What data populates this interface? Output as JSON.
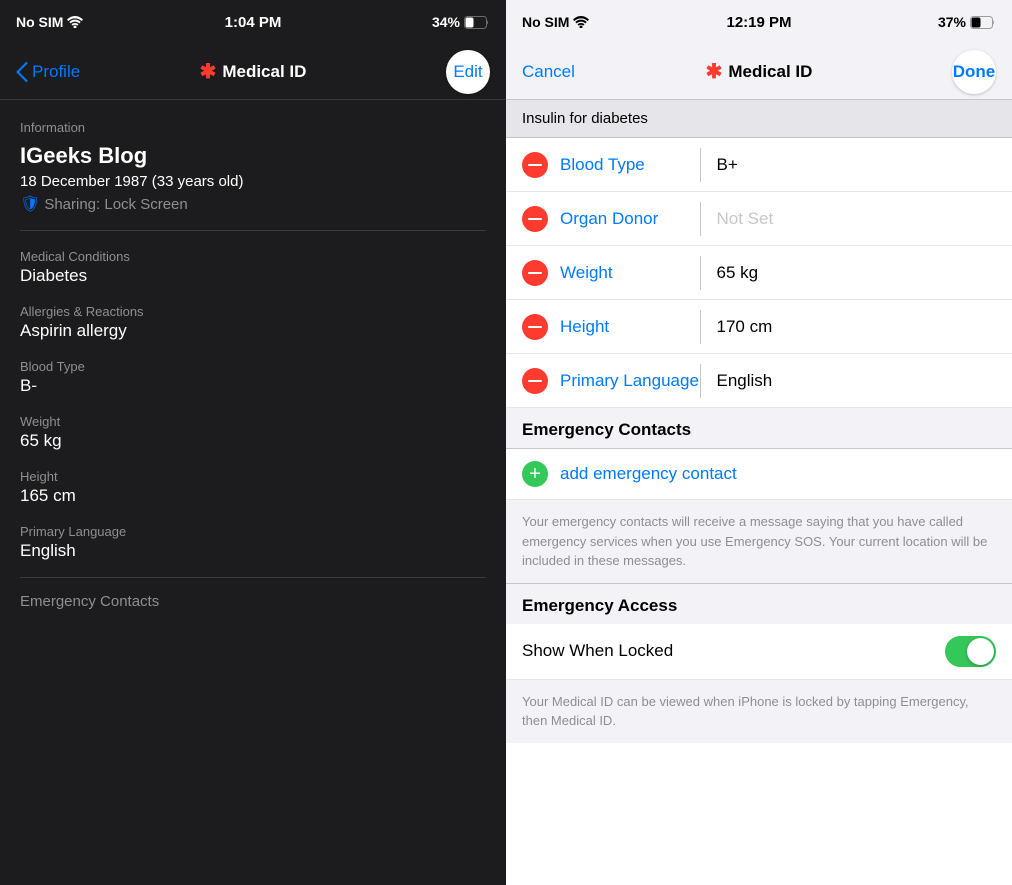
{
  "left": {
    "status": {
      "carrier": "No SIM",
      "time": "1:04 PM",
      "battery": "34%"
    },
    "nav": {
      "back_label": "Profile",
      "title": "Medical ID",
      "action_label": "Edit"
    },
    "section_info": "Information",
    "name": "IGeeks Blog",
    "dob": "18 December 1987 (33 years old)",
    "sharing": "Sharing: Lock Screen",
    "fields": [
      {
        "label": "Medical Conditions",
        "value": "Diabetes"
      },
      {
        "label": "Allergies & Reactions",
        "value": "Aspirin allergy"
      },
      {
        "label": "Blood Type",
        "value": "B-"
      },
      {
        "label": "Weight",
        "value": "65 kg"
      },
      {
        "label": "Height",
        "value": "165 cm"
      },
      {
        "label": "Primary Language",
        "value": "English"
      },
      {
        "label": "",
        "value": "Emergency Contacts"
      }
    ]
  },
  "right": {
    "status": {
      "carrier": "No SIM",
      "time": "12:19 PM",
      "battery": "37%"
    },
    "nav": {
      "cancel_label": "Cancel",
      "title": "Medical ID",
      "done_label": "Done"
    },
    "subtitle": "Insulin for diabetes",
    "rows": [
      {
        "label": "Blood Type",
        "value": "B+"
      },
      {
        "label": "Organ Donor",
        "value": "Not Set"
      },
      {
        "label": "Weight",
        "value": "65 kg"
      },
      {
        "label": "Height",
        "value": "170 cm"
      },
      {
        "label": "Primary Language",
        "value": "English"
      }
    ],
    "emergency_contacts_header": "Emergency Contacts",
    "add_contact_label": "add emergency contact",
    "contact_note": "Your emergency contacts will receive a message saying that you have called emergency services when you use Emergency SOS. Your current location will be included in these messages.",
    "access_header": "Emergency Access",
    "toggle_label": "Show When Locked",
    "toggle_on": true,
    "access_note": "Your Medical ID can be viewed when iPhone is locked by tapping Emergency, then Medical ID."
  },
  "icons": {
    "chevron_left": "‹",
    "asterisk": "✱",
    "shield": "🛡"
  }
}
